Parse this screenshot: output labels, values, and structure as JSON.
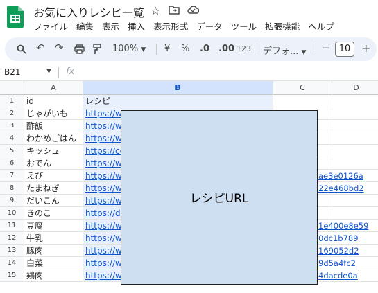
{
  "title_bar": {
    "doc_title": "お気に入りレシピ一覧",
    "logo_color": "#0f9d58"
  },
  "menu": [
    "ファイル",
    "編集",
    "表示",
    "挿入",
    "表示形式",
    "データ",
    "ツール",
    "拡張機能",
    "ヘルプ"
  ],
  "toolbar": {
    "zoom": "100%",
    "currency": "¥",
    "percent": "%",
    "decimal_decrease": ".0",
    "decimal_increase": ".00",
    "number_format": "123",
    "font": "デフォ...",
    "font_minus": "−",
    "font_size": "10",
    "font_plus": "+"
  },
  "formula_bar": {
    "cell_ref": "B21",
    "fx": "fx"
  },
  "columns": [
    "A",
    "B",
    "C",
    "D"
  ],
  "rows": [
    "1",
    "2",
    "3",
    "4",
    "5",
    "6",
    "7",
    "8",
    "9",
    "10",
    "11",
    "12",
    "13",
    "14",
    "15"
  ],
  "col_a": [
    "id",
    "じゃがいも",
    "酢飯",
    "わかめごはん",
    "キッシュ",
    "おでん",
    "えび",
    "たまねぎ",
    "だいこん",
    "きのこ",
    "豆腐",
    "牛乳",
    "豚肉",
    "白菜",
    "鶏肉"
  ],
  "col_b": [
    "レシピ",
    "https://ww",
    "https://ww",
    "https://ww",
    "https://coo",
    "https://ww",
    "https://ww",
    "https://ww",
    "https://ww",
    "https://deli",
    "https://ww",
    "https://ww",
    "https://ww",
    "https://ww",
    "https://ww"
  ],
  "url_tails": {
    "r7": "ae3e0126a",
    "r8": "22e468bd2",
    "r11": "1e400e8e59",
    "r12": "0dc1b789",
    "r13": "169052d2",
    "r14": "9d5a4fc2",
    "r15": "4dacde0a"
  },
  "overlay": {
    "label": "レシピURL",
    "fill": "#cfdff2"
  },
  "colors": {
    "toolbar_bg": "#edf2fa",
    "selected_header": "#d3e3fd",
    "link": "#1155cc"
  }
}
